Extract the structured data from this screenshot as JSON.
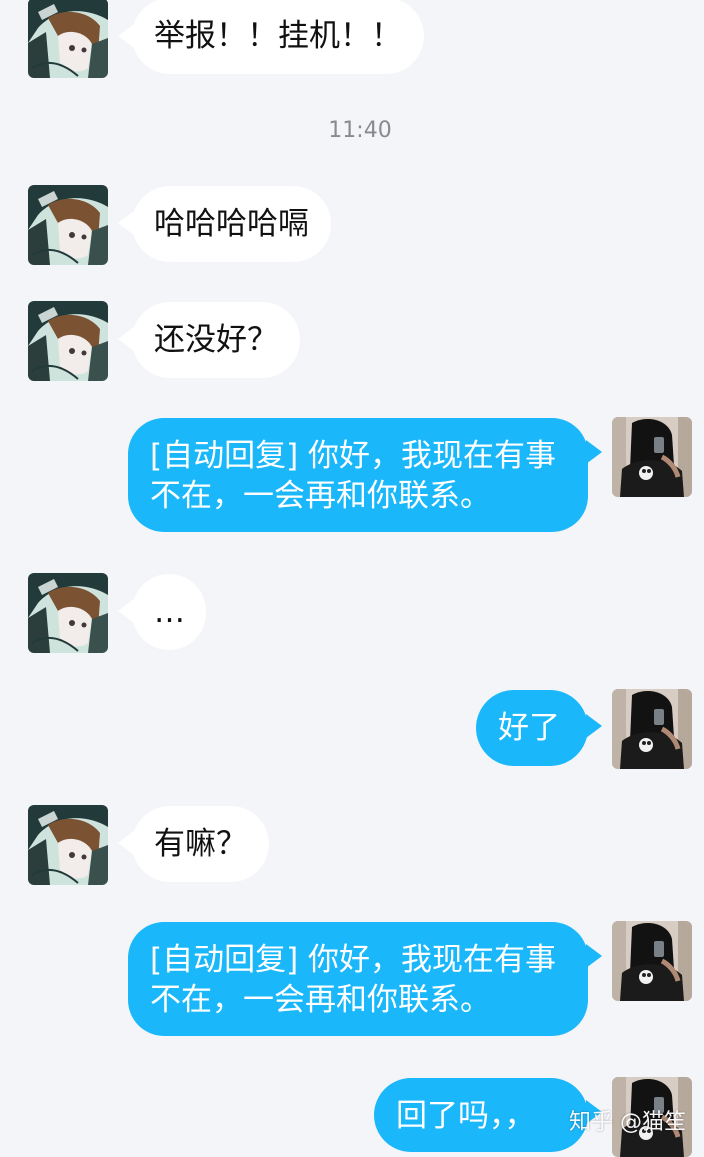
{
  "timestamp": "11:40",
  "messages": [
    {
      "from": "other",
      "text": "举报！！挂机！！"
    },
    {
      "from": "other",
      "text": "哈哈哈哈嗝"
    },
    {
      "from": "other",
      "text": "还没好？"
    },
    {
      "from": "me",
      "text": "[自动回复] 你好，我现在有事不在，一会再和你联系。"
    },
    {
      "from": "other",
      "text": "…"
    },
    {
      "from": "me",
      "text": "好了"
    },
    {
      "from": "other",
      "text": "有嘛？"
    },
    {
      "from": "me",
      "text": "[自动回复] 你好，我现在有事不在，一会再和你联系。"
    },
    {
      "from": "me",
      "text": "回了吗，，"
    }
  ],
  "watermark": "知乎 @猫笙",
  "colors": {
    "background": "#f4f5f9",
    "bubble_in": "#ffffff",
    "bubble_out": "#1ab7fa",
    "text_in": "#111111",
    "text_out": "#ffffff",
    "timestamp": "#888a8f"
  },
  "icons": {
    "other_avatar": "anime-character-avatar",
    "self_avatar": "dark-photo-avatar"
  }
}
